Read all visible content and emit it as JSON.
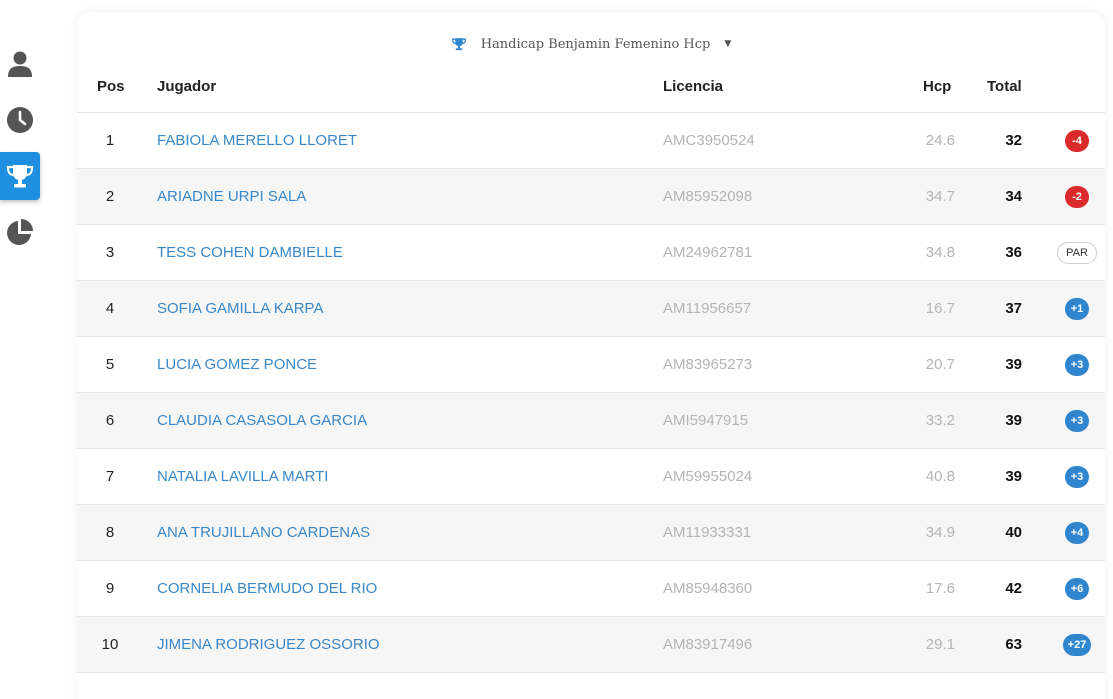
{
  "colors": {
    "accent": "#1e8fe0",
    "link": "#3a87c7",
    "negative": "#d92b2b",
    "positive": "#2f86cf",
    "muted": "#b4b4b4"
  },
  "nav": {
    "items": [
      {
        "icon": "user-icon",
        "active": false
      },
      {
        "icon": "clock-icon",
        "active": false
      },
      {
        "icon": "trophy-icon",
        "active": true
      },
      {
        "icon": "pie-chart-icon",
        "active": false
      }
    ]
  },
  "header": {
    "icon": "trophy-icon",
    "title": "Handicap Benjamin Femenino Hcp",
    "dropdown_icon": "caret-down-icon"
  },
  "table": {
    "columns": {
      "pos": "Pos",
      "player": "Jugador",
      "license": "Licencia",
      "hcp": "Hcp",
      "total": "Total"
    },
    "rows": [
      {
        "pos": "1",
        "player": "FABIOLA MERELLO LLORET",
        "license": "AMC3950524",
        "hcp": "24.6",
        "total": "32",
        "diff": "-4",
        "diff_type": "neg"
      },
      {
        "pos": "2",
        "player": "ARIADNE URPI SALA",
        "license": "AM85952098",
        "hcp": "34.7",
        "total": "34",
        "diff": "-2",
        "diff_type": "neg"
      },
      {
        "pos": "3",
        "player": "TESS COHEN DAMBIELLE",
        "license": "AM24962781",
        "hcp": "34.8",
        "total": "36",
        "diff": "PAR",
        "diff_type": "par"
      },
      {
        "pos": "4",
        "player": "SOFIA GAMILLA KARPA",
        "license": "AM11956657",
        "hcp": "16.7",
        "total": "37",
        "diff": "+1",
        "diff_type": "pos"
      },
      {
        "pos": "5",
        "player": "LUCIA GOMEZ PONCE",
        "license": "AM83965273",
        "hcp": "20.7",
        "total": "39",
        "diff": "+3",
        "diff_type": "pos"
      },
      {
        "pos": "6",
        "player": "CLAUDIA CASASOLA GARCIA",
        "license": "AMI5947915",
        "hcp": "33.2",
        "total": "39",
        "diff": "+3",
        "diff_type": "pos"
      },
      {
        "pos": "7",
        "player": "NATALIA LAVILLA MARTI",
        "license": "AM59955024",
        "hcp": "40.8",
        "total": "39",
        "diff": "+3",
        "diff_type": "pos"
      },
      {
        "pos": "8",
        "player": "ANA TRUJILLANO CARDENAS",
        "license": "AM11933331",
        "hcp": "34.9",
        "total": "40",
        "diff": "+4",
        "diff_type": "pos"
      },
      {
        "pos": "9",
        "player": "CORNELIA BERMUDO DEL RIO",
        "license": "AM85948360",
        "hcp": "17.6",
        "total": "42",
        "diff": "+6",
        "diff_type": "pos"
      },
      {
        "pos": "10",
        "player": "JIMENA RODRIGUEZ OSSORIO",
        "license": "AM83917496",
        "hcp": "29.1",
        "total": "63",
        "diff": "+27",
        "diff_type": "pos"
      }
    ]
  }
}
